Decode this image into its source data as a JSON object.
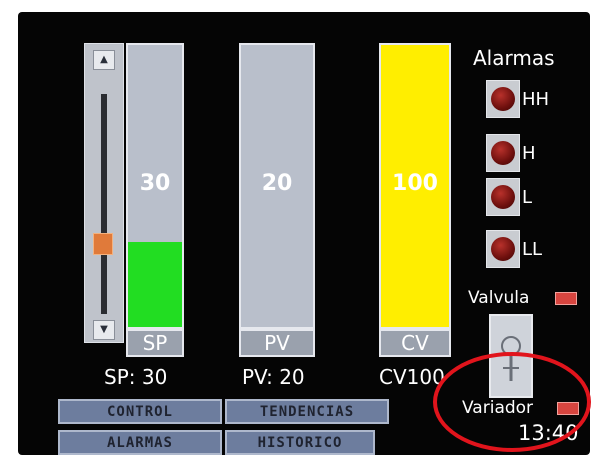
{
  "colors": {
    "screen_bg": "#050505",
    "bar_track": "#b9bfcb",
    "sp_fill": "#22dd22",
    "cv_fill": "#ffee00",
    "nav_button": "#6d7d9e",
    "alarm_lamp_off": "#6d0f0d",
    "indicator_red": "#d7453f",
    "slider_thumb": "#e07a3a",
    "annotation_ring": "#e1141c"
  },
  "slider": {
    "up_icon": "▲",
    "down_icon": "▼",
    "level_fraction": 0.3
  },
  "bars": {
    "sp": {
      "value": "30",
      "label": "SP",
      "readout": "SP: 30",
      "level": 0.3
    },
    "pv": {
      "value": "20",
      "label": "PV",
      "readout": "PV: 20",
      "level": 0
    },
    "cv": {
      "value": "100",
      "label": "CV",
      "readout": "CV100",
      "level": 1.0
    }
  },
  "alarms": {
    "title": "Alarmas",
    "items": [
      {
        "label": "HH",
        "icon": "alarm-lamp-icon"
      },
      {
        "label": "H",
        "icon": "alarm-lamp-icon"
      },
      {
        "label": "L",
        "icon": "alarm-lamp-icon"
      },
      {
        "label": "LL",
        "icon": "alarm-lamp-icon"
      }
    ]
  },
  "valve": {
    "label": "Valvula",
    "graphic_icon": "valve-icon"
  },
  "variator": {
    "label": "Variador"
  },
  "nav": {
    "control": "CONTROL",
    "tendencias": "TENDENCIAS",
    "alarmas": "ALARMAS",
    "historico": "HISTORICO"
  },
  "clock": {
    "time": "13:40"
  }
}
